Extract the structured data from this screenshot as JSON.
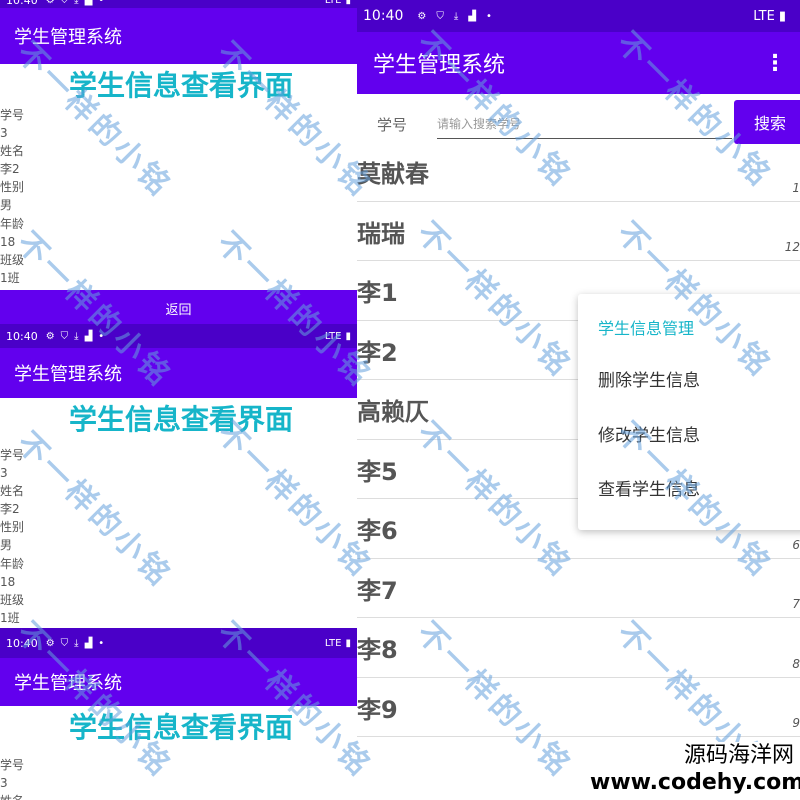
{
  "status": {
    "time": "10:40",
    "network": "LTE"
  },
  "app_title": "学生管理系统",
  "detail": {
    "heading": "学生信息查看界面",
    "fields": [
      {
        "label": "学号",
        "value": "3"
      },
      {
        "label": "姓名",
        "value": "李2"
      },
      {
        "label": "性别",
        "value": "男"
      },
      {
        "label": "年龄",
        "value": "18"
      },
      {
        "label": "班级",
        "value": "1班"
      }
    ],
    "back_label": "返回"
  },
  "search": {
    "label": "学号",
    "placeholder": "请输入搜索学号",
    "button": "搜索"
  },
  "students": [
    {
      "name": "莫献春",
      "num": "1"
    },
    {
      "name": "瑞瑞",
      "num": "12"
    },
    {
      "name": "李1",
      "num": ""
    },
    {
      "name": "李2",
      "num": ""
    },
    {
      "name": "高赖仄",
      "num": ""
    },
    {
      "name": "李5",
      "num": ""
    },
    {
      "name": "李6",
      "num": "6"
    },
    {
      "name": "李7",
      "num": "7"
    },
    {
      "name": "李8",
      "num": "8"
    },
    {
      "name": "李9",
      "num": "9"
    }
  ],
  "menu": {
    "header": "学生信息管理",
    "items": [
      "删除学生信息",
      "修改学生信息",
      "查看学生信息"
    ]
  },
  "watermark": "不一样的小铭",
  "footer": {
    "line1": "源码海洋网",
    "line2": "www.codehy.com"
  },
  "colors": {
    "primary": "#6200ee",
    "status": "#4a00c8",
    "accent": "#16b5c9"
  }
}
